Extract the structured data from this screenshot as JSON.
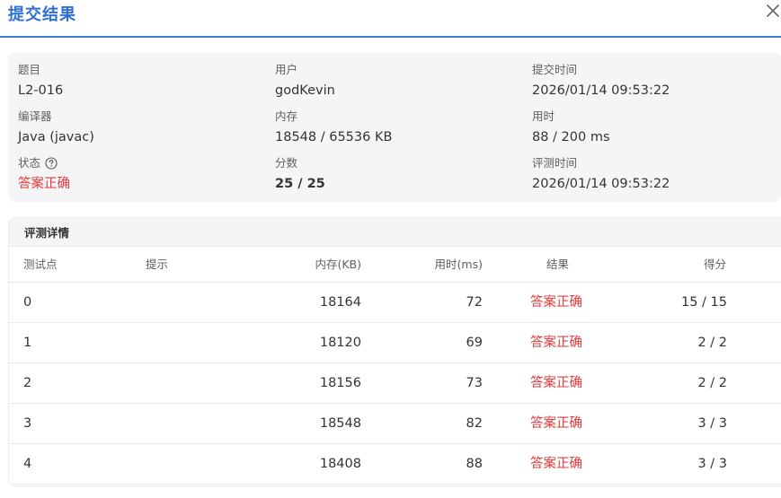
{
  "dialog": {
    "title": "提交结果",
    "close_icon": "close-icon"
  },
  "summary": {
    "problem": {
      "label": "题目",
      "value": "L2-016"
    },
    "user": {
      "label": "用户",
      "value": "godKevin"
    },
    "submit_time": {
      "label": "提交时间",
      "value": "2026/01/14 09:53:22"
    },
    "compiler": {
      "label": "编译器",
      "value": "Java (javac)"
    },
    "memory": {
      "label": "内存",
      "value": "18548 / 65536 KB"
    },
    "time_used": {
      "label": "用时",
      "value": "88 / 200 ms"
    },
    "status": {
      "label": "状态",
      "value": "答案正确",
      "help_icon": "question-circle-icon"
    },
    "score": {
      "label": "分数",
      "value": "25 / 25"
    },
    "judge_time": {
      "label": "评测时间",
      "value": "2026/01/14 09:53:22"
    }
  },
  "details": {
    "title": "评测详情",
    "columns": [
      "测试点",
      "提示",
      "内存(KB)",
      "用时(ms)",
      "结果",
      "得分"
    ],
    "rows": [
      {
        "case": "0",
        "hint": "",
        "memory": "18164",
        "time": "72",
        "result": "答案正确",
        "score": "15 / 15"
      },
      {
        "case": "1",
        "hint": "",
        "memory": "18120",
        "time": "69",
        "result": "答案正确",
        "score": "2 / 2"
      },
      {
        "case": "2",
        "hint": "",
        "memory": "18156",
        "time": "73",
        "result": "答案正确",
        "score": "2 / 2"
      },
      {
        "case": "3",
        "hint": "",
        "memory": "18548",
        "time": "82",
        "result": "答案正确",
        "score": "3 / 3"
      },
      {
        "case": "4",
        "hint": "",
        "memory": "18408",
        "time": "88",
        "result": "答案正确",
        "score": "3 / 3"
      }
    ]
  },
  "colors": {
    "accent": "#2f6fd6",
    "success_text": "#e23b3b",
    "panel_bg": "#f5f5f7"
  }
}
